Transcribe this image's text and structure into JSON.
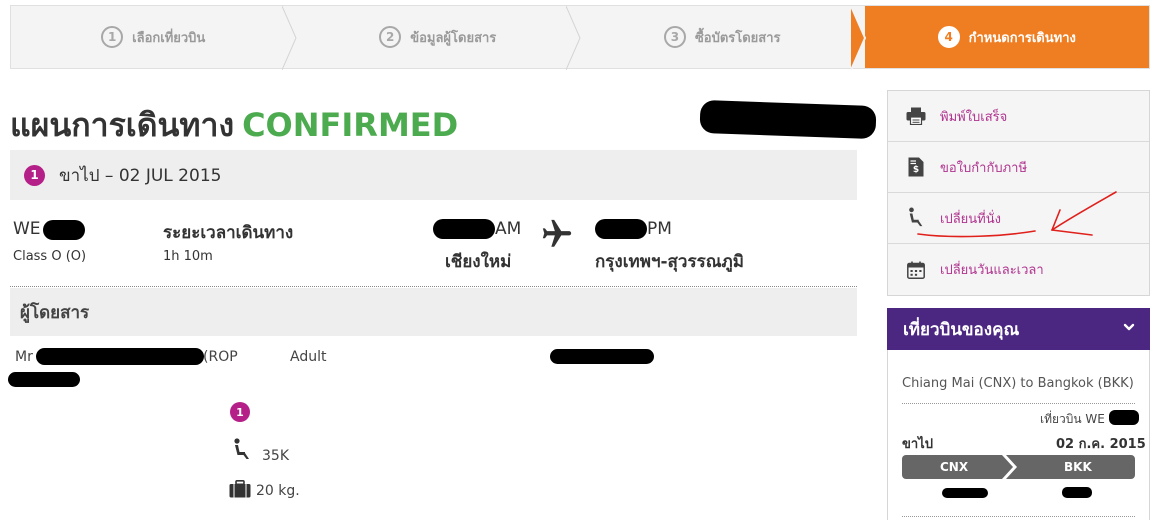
{
  "steps": [
    {
      "num": "1",
      "label": "เลือกเที่ยวบิน"
    },
    {
      "num": "2",
      "label": "ข้อมูลผู้โดยสาร"
    },
    {
      "num": "3",
      "label": "ซื้อบัตรโดยสาร"
    },
    {
      "num": "4",
      "label": "กำหนดการเดินทาง"
    }
  ],
  "title": {
    "text": "แผนการเดินทาง",
    "status": "CONFIRMED"
  },
  "leg": {
    "badge": "1",
    "label": "ขาไป – 02 JUL 2015"
  },
  "flight": {
    "number_prefix": "WE",
    "class": "Class O (O)",
    "duration_label": "ระยะเวลาเดินทาง",
    "duration": "1h 10m",
    "depart_suffix": "AM",
    "depart_city": "เชียงใหม่",
    "arrive_suffix": "PM",
    "arrive_city": "กรุงเทพฯ-สุวรรณภูมิ"
  },
  "passengers": {
    "header": "ผู้โดยสาร",
    "title": "Mr",
    "name_suffix": "(ROP",
    "type": "Adult",
    "badge": "1",
    "seat": "35K",
    "baggage": "20 kg."
  },
  "side_menu": [
    {
      "label": "พิมพ์ใบเสร็จ",
      "icon": "printer-icon"
    },
    {
      "label": "ขอใบกำกับภาษี",
      "icon": "tax-invoice-icon"
    },
    {
      "label": "เปลี่ยนที่นั่ง",
      "icon": "seat-icon"
    },
    {
      "label": "เปลี่ยนวันและเวลา",
      "icon": "calendar-icon"
    }
  ],
  "your_flight": {
    "header": "เที่ยวบินของคุณ",
    "route": "Chiang Mai (CNX) to Bangkok (BKK)",
    "flight_label": "เที่ยวบิน WE",
    "direction": "ขาไป",
    "date": "02 ก.ค. 2015",
    "origin": "CNX",
    "destination": "BKK"
  },
  "colors": {
    "accent_orange": "#ef7e22",
    "confirmed_green": "#4caa4f",
    "magenta": "#b51f88",
    "purple": "#4b2782",
    "annotation_red": "#e0201b"
  }
}
